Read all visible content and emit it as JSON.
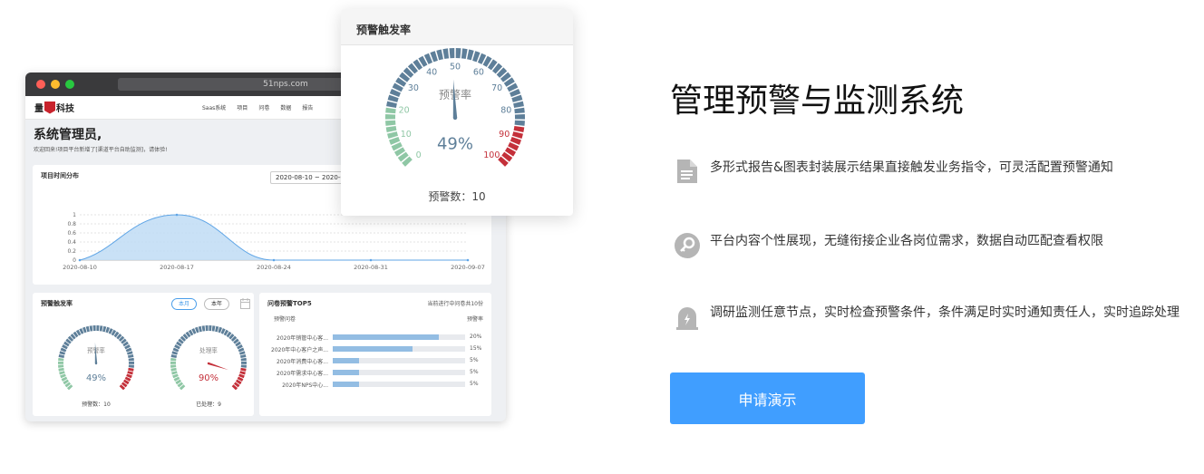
{
  "browser": {
    "url": "51nps.com",
    "logo": {
      "pre": "量",
      "post": "科技"
    },
    "nav": [
      "Saas系统",
      "项目",
      "问卷",
      "数据",
      "报告"
    ]
  },
  "dashboard": {
    "greeting_title": "系统管理员,",
    "greeting_sub": "欢迎回来!项目平台新增了[渠道平台自助监测]，请体验!",
    "distribution": {
      "title": "项目时间分布",
      "date_range": "2020-08-10 ~ 2020-09-07"
    },
    "alert_rate": {
      "title": "预警触发率",
      "tab_month": "本月",
      "tab_year": "本年",
      "gauge1": {
        "label": "预警率",
        "value_text": "49%",
        "footer": "预警数：10"
      },
      "gauge2": {
        "label": "处理率",
        "value_text": "90%",
        "footer": "已处理：9"
      }
    },
    "top5": {
      "title": "问卷预警TOP5",
      "subtitle": "当前进行中问卷共10份",
      "col_left": "预警问卷",
      "col_right": "预警率",
      "rows": [
        {
          "name": "2020年销管中心客...",
          "value": 20,
          "label": "20%"
        },
        {
          "name": "2020年中心客户之声...",
          "value": 15,
          "label": "15%"
        },
        {
          "name": "2020年消费中心客...",
          "value": 5,
          "label": "5%"
        },
        {
          "name": "2020年需求中心客...",
          "value": 5,
          "label": "5%"
        },
        {
          "name": "2020年NPS中心...",
          "value": 5,
          "label": "5%"
        }
      ]
    }
  },
  "chart_data": [
    {
      "type": "area",
      "title": "项目时间分布",
      "x": [
        "2020-08-10",
        "2020-08-17",
        "2020-08-24",
        "2020-08-31",
        "2020-09-07"
      ],
      "values": [
        0,
        1,
        0,
        0,
        0
      ],
      "ylim": [
        0,
        1
      ],
      "yticks": [
        "0",
        "0.2",
        "0.4",
        "0.6",
        "0.8",
        "1"
      ],
      "grid": true
    },
    {
      "type": "gauge",
      "title": "预警触发率",
      "label": "预警率",
      "value": 49,
      "range": [
        0,
        100
      ],
      "ticks": [
        "0",
        "10",
        "20",
        "30",
        "40",
        "50",
        "60",
        "70",
        "80",
        "90",
        "100"
      ]
    }
  ],
  "floating_card": {
    "title": "预警触发率",
    "gauge_label": "预警率",
    "value_text": "49%",
    "footer": "预警数：10"
  },
  "hero": {
    "title": "管理预警与监测系统",
    "features": [
      {
        "icon": "document-icon",
        "text": "多形式报告&图表封装展示结果直接触发业务指令，可灵活配置预警通知"
      },
      {
        "icon": "key-icon",
        "text": "平台内容个性展现，无缝衔接企业各岗位需求，数据自动匹配查看权限"
      },
      {
        "icon": "alarm-icon",
        "text": "调研监测任意节点，实时检查预警条件，条件满足时实时通知责任人，实时追踪处理"
      }
    ],
    "cta": "申请演示"
  },
  "colors": {
    "accent": "#409eff",
    "gauge_low": "#8fc7a5",
    "gauge_mid": "#5e7f99",
    "gauge_high": "#c4303a",
    "area_fill": "#bfdcf5",
    "area_line": "#5fa5e6"
  }
}
